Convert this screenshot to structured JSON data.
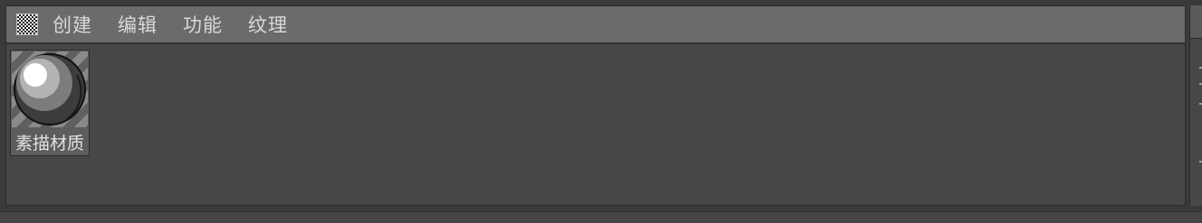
{
  "menubar": {
    "icon": "grid-pattern-icon",
    "items": [
      {
        "label": "创建"
      },
      {
        "label": "编辑"
      },
      {
        "label": "功能"
      },
      {
        "label": "纹理"
      }
    ]
  },
  "materials": [
    {
      "label": "素描材质",
      "icon": "sphere-material-icon"
    }
  ],
  "colors": {
    "menubar_bg": "#6b6b6b",
    "panel_bg": "#474747",
    "text": "#d9d9d9"
  }
}
